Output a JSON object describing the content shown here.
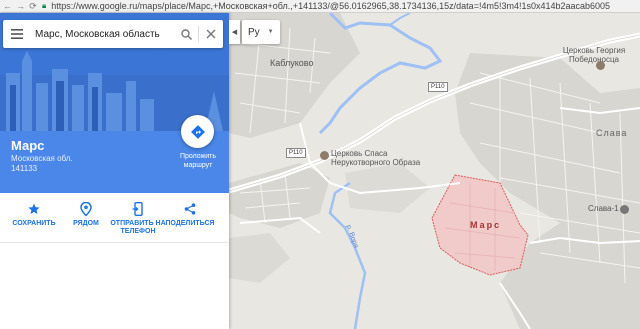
{
  "browser": {
    "url": "https://www.google.ru/maps/place/Марс,+Московская+обл.,+141133/@56.0162965,38.1734136,15z/data=!4m5!3m4!1s0x414b2aacab6005"
  },
  "search": {
    "query": "Марс, Московская область"
  },
  "place": {
    "name": "Марс",
    "region": "Московская обл.",
    "postal_code": "141133",
    "route_label": "Проложить маршрут"
  },
  "actions": [
    {
      "label": "СОХРАНИТЬ",
      "icon": "star-icon"
    },
    {
      "label": "РЯДОМ",
      "icon": "nearby-pin-icon"
    },
    {
      "label": "ОТПРАВИТЬ НА ТЕЛЕФОН",
      "icon": "send-to-phone-icon"
    },
    {
      "label": "ПОДЕЛИТЬСЯ",
      "icon": "share-icon"
    }
  ],
  "map": {
    "language": "Ру",
    "labels": {
      "kablukovo": "Каблуково",
      "church_spas": "Церковь Спаса Нерукотворного Образа",
      "church_georgy": "Церковь Георгия Победоносца",
      "slava": "Слава",
      "slava1": "Слава-1",
      "mars": "Марс",
      "river": "р. Воря"
    },
    "road": "P110",
    "colors": {
      "accent": "#4a87e8",
      "highlight_area": "#f2c9c9",
      "water": "#9ec0f5"
    }
  }
}
